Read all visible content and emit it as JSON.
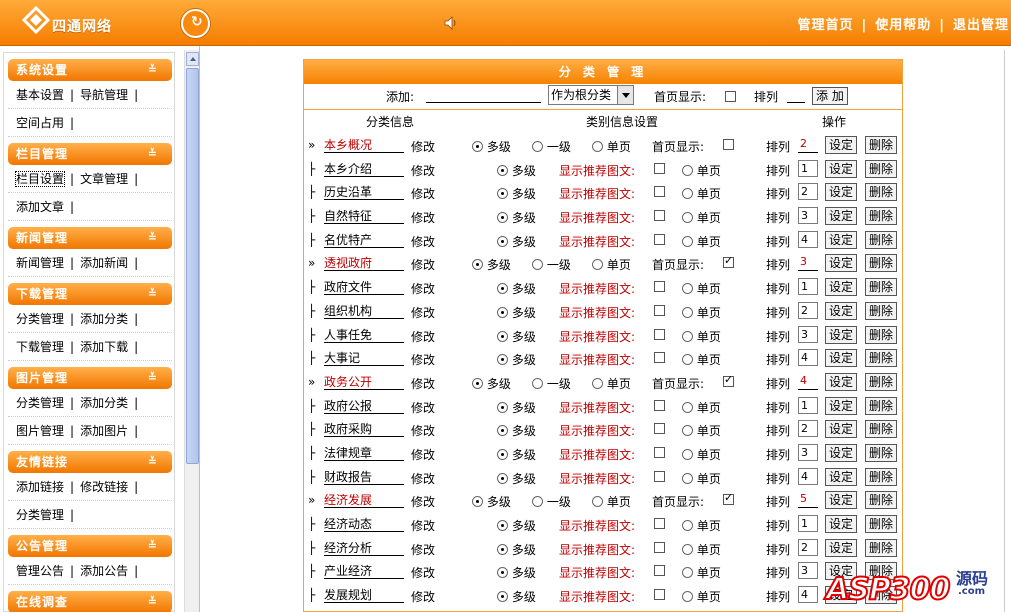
{
  "header": {
    "logo_text": "四通网络",
    "nav": [
      "管理首页",
      "使用帮助",
      "退出管理"
    ]
  },
  "sidebar": {
    "sections": [
      {
        "title": "系统设置",
        "rows": [
          [
            "基本设置",
            "导航管理"
          ],
          [
            "空间占用"
          ]
        ]
      },
      {
        "title": "栏目管理",
        "rows": [
          [
            "栏目设置",
            "文章管理"
          ],
          [
            "添加文章"
          ]
        ]
      },
      {
        "title": "新闻管理",
        "rows": [
          [
            "新闻管理",
            "添加新闻"
          ]
        ]
      },
      {
        "title": "下载管理",
        "rows": [
          [
            "分类管理",
            "添加分类"
          ],
          [
            "下载管理",
            "添加下载"
          ]
        ]
      },
      {
        "title": "图片管理",
        "rows": [
          [
            "分类管理",
            "添加分类"
          ],
          [
            "图片管理",
            "添加图片"
          ]
        ]
      },
      {
        "title": "友情链接",
        "rows": [
          [
            "添加链接",
            "修改链接"
          ],
          [
            "分类管理"
          ]
        ]
      },
      {
        "title": "公告管理",
        "rows": [
          [
            "管理公告",
            "添加公告"
          ]
        ]
      },
      {
        "title": "在线调查",
        "rows": []
      }
    ]
  },
  "main": {
    "title": "分 类 管 理",
    "add": {
      "label": "添加:",
      "select_value": "作为根分类",
      "home_label": "首页显示:",
      "sort_label": "排列",
      "button": "添 加"
    },
    "columns": [
      "分类信息",
      "类别信息设置",
      "操作"
    ],
    "labels": {
      "edit": "修改",
      "multi": "多级",
      "single_level": "一级",
      "single_page": "单页",
      "home_show": "首页显示:",
      "recommend": "显示推荐图文:",
      "sort": "排列",
      "set": "设定",
      "delete": "删除"
    },
    "rows": [
      {
        "type": "parent",
        "name": "本乡概况",
        "sort": "2",
        "home_checked": false
      },
      {
        "type": "child",
        "name": "本乡介绍",
        "sort": "1"
      },
      {
        "type": "child",
        "name": "历史沿革",
        "sort": "2"
      },
      {
        "type": "child",
        "name": "自然特征",
        "sort": "3"
      },
      {
        "type": "child",
        "name": "名优特产",
        "sort": "4"
      },
      {
        "type": "parent",
        "name": "透视政府",
        "sort": "3",
        "home_checked": true
      },
      {
        "type": "child",
        "name": "政府文件",
        "sort": "1"
      },
      {
        "type": "child",
        "name": "组织机构",
        "sort": "2"
      },
      {
        "type": "child",
        "name": "人事任免",
        "sort": "3"
      },
      {
        "type": "child",
        "name": "大事记",
        "sort": "4"
      },
      {
        "type": "parent",
        "name": "政务公开",
        "sort": "4",
        "home_checked": true
      },
      {
        "type": "child",
        "name": "政府公报",
        "sort": "1"
      },
      {
        "type": "child",
        "name": "政府采购",
        "sort": "2"
      },
      {
        "type": "child",
        "name": "法律规章",
        "sort": "3"
      },
      {
        "type": "child",
        "name": "财政报告",
        "sort": "4"
      },
      {
        "type": "parent",
        "name": "经济发展",
        "sort": "5",
        "home_checked": true
      },
      {
        "type": "child",
        "name": "经济动态",
        "sort": "1"
      },
      {
        "type": "child",
        "name": "经济分析",
        "sort": "2"
      },
      {
        "type": "child",
        "name": "产业经济",
        "sort": "3"
      },
      {
        "type": "child",
        "name": "发展规划",
        "sort": "4"
      }
    ]
  },
  "watermark": {
    "brand": "ASP300",
    "cn": "源码",
    "suffix": ".com"
  }
}
